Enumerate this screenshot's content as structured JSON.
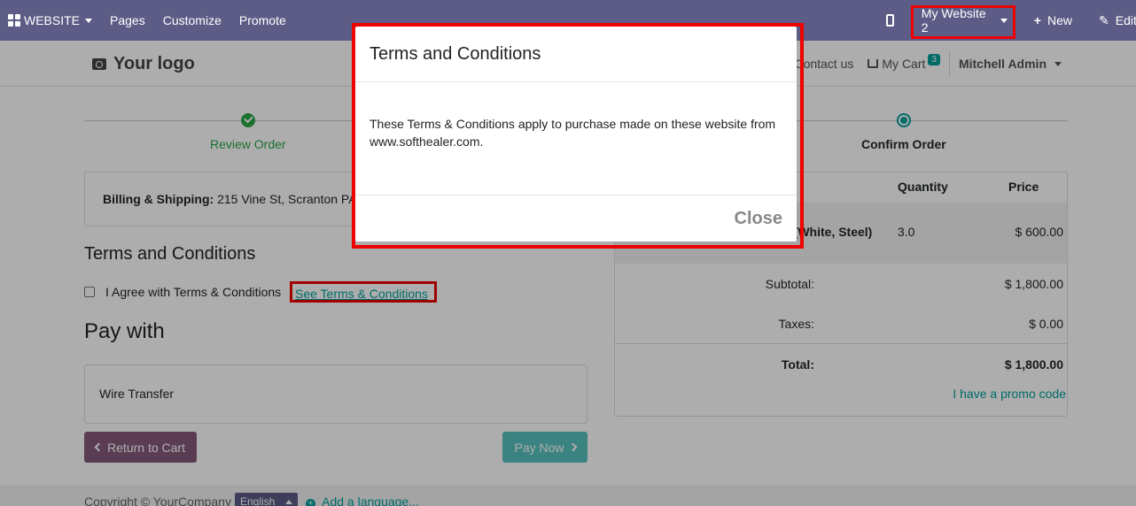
{
  "topbar": {
    "app_menu": "WEBSITE",
    "pages": "Pages",
    "customize": "Customize",
    "promote": "Promote",
    "website_switch": "My Website 2",
    "new": "New",
    "edit": "Edit"
  },
  "header": {
    "logo": "Your logo",
    "contact": "Contact us",
    "cart": "My Cart",
    "cart_count": "3",
    "user": "Mitchell Admin"
  },
  "wizard": {
    "step1": "Review Order",
    "step3": "Confirm Order"
  },
  "billing": {
    "label": "Billing & Shipping:",
    "value": "215 Vine St, Scranton PA"
  },
  "terms": {
    "heading": "Terms and Conditions",
    "agree_label": "I Agree with Terms & Conditions",
    "see_link": "See Terms & Conditions"
  },
  "payment": {
    "heading": "Pay with",
    "method": "Wire Transfer",
    "back_button": "Return to Cart",
    "pay_button": "Pay Now"
  },
  "order": {
    "col_quantity": "Quantity",
    "col_price": "Price",
    "product_fragment": "k (White, Steel)",
    "product_qty": "3.0",
    "product_price": "$ 600.00",
    "subtotal_label": "Subtotal:",
    "subtotal_value": "$ 1,800.00",
    "taxes_label": "Taxes:",
    "taxes_value": "$ 0.00",
    "total_label": "Total:",
    "total_value": "$ 1,800.00",
    "promo": "I have a promo code"
  },
  "footer": {
    "copyright": "Copyright © YourCompany",
    "language": "English",
    "add_language": "Add a language..."
  },
  "modal": {
    "title": "Terms and Conditions",
    "body": "These Terms & Conditions apply to purchase made on these website from www.softhealer.com.",
    "close": "Close"
  }
}
